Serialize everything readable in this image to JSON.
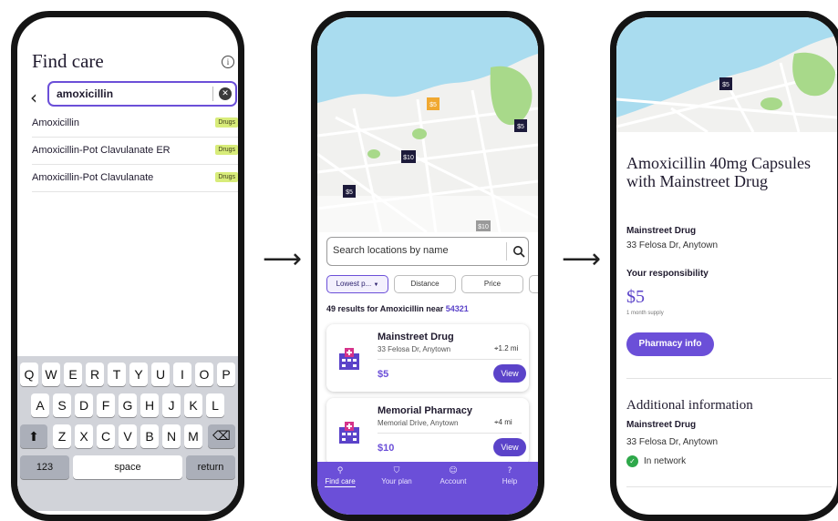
{
  "find_care": {
    "title": "Find care",
    "search_value": "amoxicillin",
    "results": [
      {
        "name": "Amoxicillin",
        "tag": "Drugs"
      },
      {
        "name": "Amoxicillin-Pot Clavulanate ER",
        "tag": "Drugs"
      },
      {
        "name": "Amoxicillin-Pot Clavulanate",
        "tag": "Drugs"
      }
    ],
    "keyboard": {
      "row1": [
        "Q",
        "W",
        "E",
        "R",
        "T",
        "Y",
        "U",
        "I",
        "O",
        "P"
      ],
      "row2": [
        "A",
        "S",
        "D",
        "F",
        "G",
        "H",
        "J",
        "K",
        "L"
      ],
      "row3": [
        "Z",
        "X",
        "C",
        "V",
        "B",
        "N",
        "M"
      ],
      "shift": "⬆",
      "delete": "⌫",
      "numbers": "123",
      "space": "space",
      "return": "return"
    }
  },
  "locations": {
    "map_markers": [
      "$5",
      "$5",
      "$10",
      "$5",
      "$10"
    ],
    "search_placeholder": "Search locations by name",
    "filters": [
      "Lowest p...",
      "Distance",
      "Price"
    ],
    "results_prefix": "49 results for Amoxicillin near",
    "zip": "54321",
    "pharmacies": [
      {
        "name": "Mainstreet Drug",
        "address": "33 Felosa Dr, Anytown",
        "distance": "1.2 mi",
        "price": "$5",
        "action": "View"
      },
      {
        "name": "Memorial Pharmacy",
        "address": "Memorial Drive, Anytown",
        "distance": "4 mi",
        "price": "$10",
        "action": "View"
      }
    ],
    "nav": [
      {
        "label": "Find care",
        "icon": "search-icon"
      },
      {
        "label": "Your plan",
        "icon": "shield-icon"
      },
      {
        "label": "Account",
        "icon": "user-icon"
      },
      {
        "label": "Help",
        "icon": "help-icon"
      }
    ]
  },
  "detail": {
    "map_marker": "$5",
    "title": "Amoxicillin 40mg Capsules with Mainstreet Drug",
    "pharmacy_name": "Mainstreet Drug",
    "pharmacy_address": "33 Felosa Dr, Anytown",
    "responsibility_label": "Your responsibility",
    "amount": "$5",
    "supply": "1 month supply",
    "button": "Pharmacy info",
    "additional_title": "Additional information",
    "additional_name": "Mainstreet Drug",
    "additional_address": "33 Felosa Dr, Anytown",
    "network_status": "In network"
  },
  "colors": {
    "accent": "#6b4fd8",
    "drug_tag": "#d8ec7a",
    "map_water": "#a9dcef",
    "map_park": "#a8d98a",
    "in_network": "#2ea84a"
  }
}
